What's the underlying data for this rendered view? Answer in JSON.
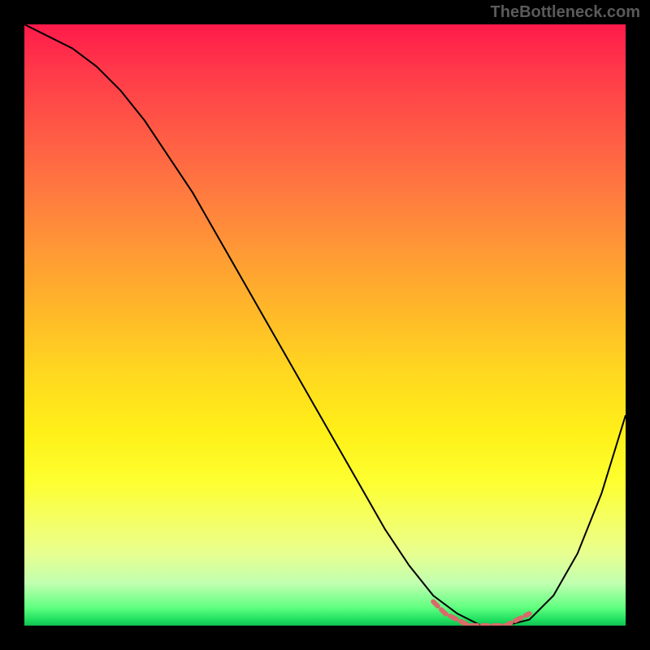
{
  "watermark": "TheBottleneck.com",
  "chart_data": {
    "type": "line",
    "title": "",
    "xlabel": "",
    "ylabel": "",
    "xlim": [
      0,
      100
    ],
    "ylim": [
      0,
      100
    ],
    "series": [
      {
        "name": "bottleneck-curve",
        "x": [
          0,
          4,
          8,
          12,
          16,
          20,
          24,
          28,
          32,
          36,
          40,
          44,
          48,
          52,
          56,
          60,
          64,
          68,
          72,
          76,
          80,
          84,
          88,
          92,
          96,
          100
        ],
        "values": [
          100,
          98,
          96,
          93,
          89,
          84,
          78,
          72,
          65,
          58,
          51,
          44,
          37,
          30,
          23,
          16,
          10,
          5,
          2,
          0,
          0,
          1,
          5,
          12,
          22,
          35
        ]
      }
    ],
    "highlight": {
      "name": "optimal-range",
      "x": [
        68,
        70,
        72,
        74,
        76,
        78,
        80,
        82,
        84
      ],
      "values": [
        4,
        2,
        1,
        0,
        0,
        0,
        0,
        1,
        2
      ],
      "color": "#d96a6a"
    },
    "background_gradient": {
      "top": "#ff1a4a",
      "mid": "#ffd820",
      "bottom": "#20e060"
    }
  }
}
